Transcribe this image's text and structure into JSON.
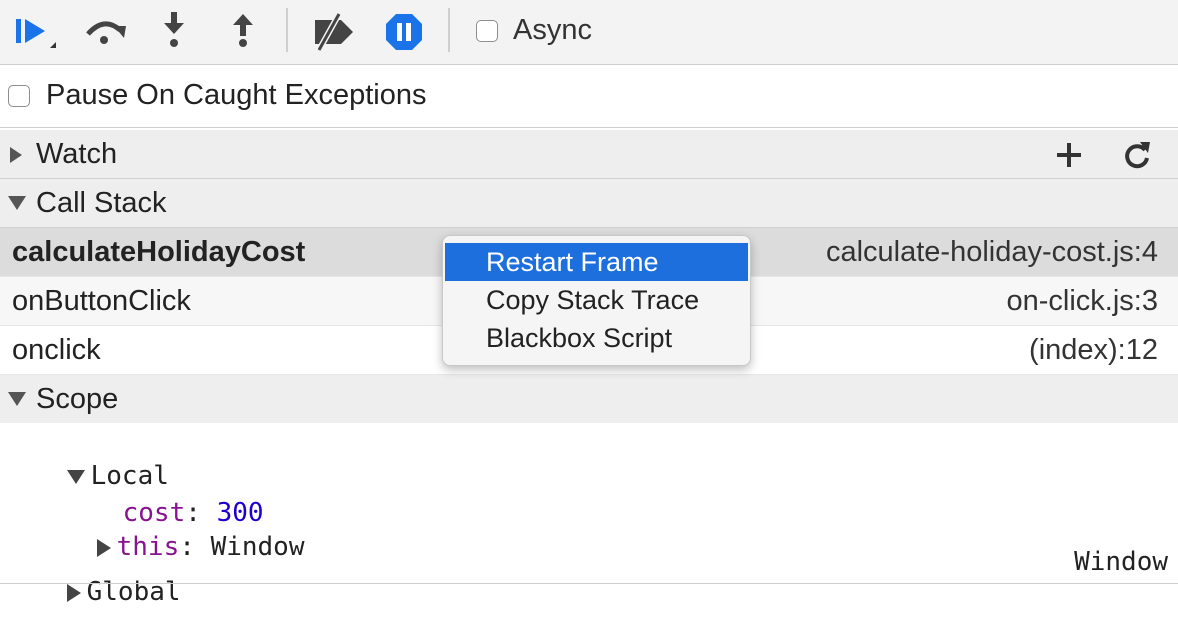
{
  "toolbar": {
    "buttons": [
      {
        "name": "resume-button",
        "icon": "resume-icon"
      },
      {
        "name": "step-over-button",
        "icon": "step-over-icon"
      },
      {
        "name": "step-into-button",
        "icon": "step-into-icon"
      },
      {
        "name": "step-out-button",
        "icon": "step-out-icon"
      },
      {
        "name": "deactivate-breakpoints-button",
        "icon": "breakpoints-off-icon"
      },
      {
        "name": "pause-on-exceptions-button",
        "icon": "pause-icon"
      }
    ],
    "async_label": "Async",
    "async_checked": false,
    "accent_color": "#1a73e8"
  },
  "pause_caught": {
    "label": "Pause On Caught Exceptions",
    "checked": false
  },
  "watch": {
    "title": "Watch",
    "expanded": false,
    "add_icon": "plus-icon",
    "refresh_icon": "refresh-icon"
  },
  "call_stack": {
    "title": "Call Stack",
    "expanded": true,
    "frames": [
      {
        "name": "calculateHolidayCost",
        "location": "calculate-holiday-cost.js:4",
        "selected": true
      },
      {
        "name": "onButtonClick",
        "location": "on-click.js:3",
        "selected": false
      },
      {
        "name": "onclick",
        "location": "(index):12",
        "selected": false
      }
    ]
  },
  "scope": {
    "title": "Scope",
    "expanded": true,
    "local": {
      "label": "Local",
      "props": [
        {
          "name": "cost",
          "sep": ": ",
          "value": "300"
        },
        {
          "name": "this",
          "sep": ": ",
          "value": "Window"
        }
      ]
    },
    "global": {
      "label": "Global",
      "value": "Window"
    }
  },
  "context_menu": {
    "items": [
      {
        "label": "Restart Frame",
        "highlighted": true
      },
      {
        "label": "Copy Stack Trace",
        "highlighted": false
      },
      {
        "label": "Blackbox Script",
        "highlighted": false
      }
    ],
    "highlight_color": "#1c6fdc"
  }
}
